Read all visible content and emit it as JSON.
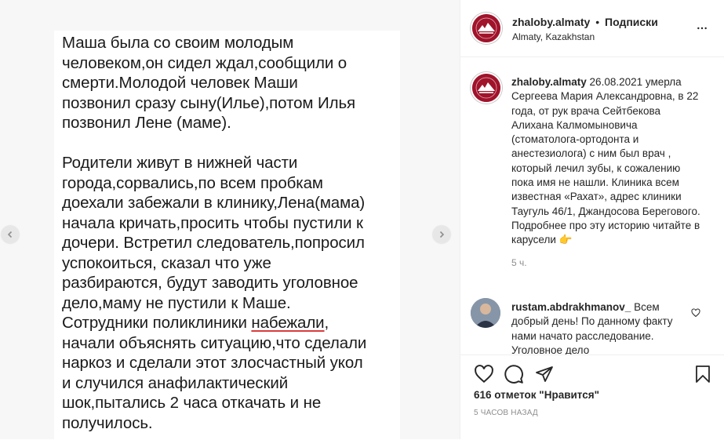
{
  "post_image": {
    "text_lines": [
      "Маша была со своим молодым",
      "человеком,он сидел ждал,сообщили о",
      "смерти.Молодой человек Маши",
      "позвонил сразу сыну(Илье),потом Илья",
      "позвонил Лене (маме).",
      "",
      "Родители живут в нижней части",
      "города,сорвались,по всем пробкам",
      "доехали забежали в клинику,Лена(мама)",
      "начала кричать,просить чтобы пустили к",
      "дочери. Встретил следователь,попросил",
      "успокоиться, сказал что уже",
      "разбираются, будут заводить уголовное",
      "дело,маму не пустили к Маше.",
      "Сотрудники поликлиники набежали,",
      "начали объяснять ситуацию,что сделали",
      "наркоз и сделали этот злосчастный укол",
      "и случился анафилактический",
      "шок,пытались 2 часа откачать и не",
      "получилось."
    ],
    "underlined_word": "набежали"
  },
  "header": {
    "username": "zhaloby.almaty",
    "separator": "•",
    "follow_label": "Подписки",
    "location": "Almaty, Kazakhstan",
    "more_icon": "more-horizontal-icon"
  },
  "caption": {
    "username": "zhaloby.almaty",
    "text": "26.08.2021 умерла Сергеева Мария Александровна, в 22 года, от рук врача Сейтбекова Алихана Калмомыновича (стоматолога-ортодонта и анестезиолога) с ним был врач , который лечил зубы, к сожалению пока имя не нашли. Клиника всем известная «Рахат», адрес клиники Таугуль 46/1, Джандосова Берегового.",
    "more_line": "Подробнее про эту историю читайте в карусели",
    "emoji": "👉",
    "time": "5 ч."
  },
  "comment": {
    "username": "rustam.abdrakhmanov_",
    "text": "Всем добрый день! По данному факту нами начато расследование. Уголовное дело"
  },
  "actions": {
    "likes": "616 отметок \"Нравится\"",
    "timestamp": "5 ЧАСОВ НАЗАД"
  },
  "colors": {
    "logo": "#a0132b",
    "text": "#262626",
    "muted": "#8e8e8e",
    "underline": "#d93b3b"
  }
}
